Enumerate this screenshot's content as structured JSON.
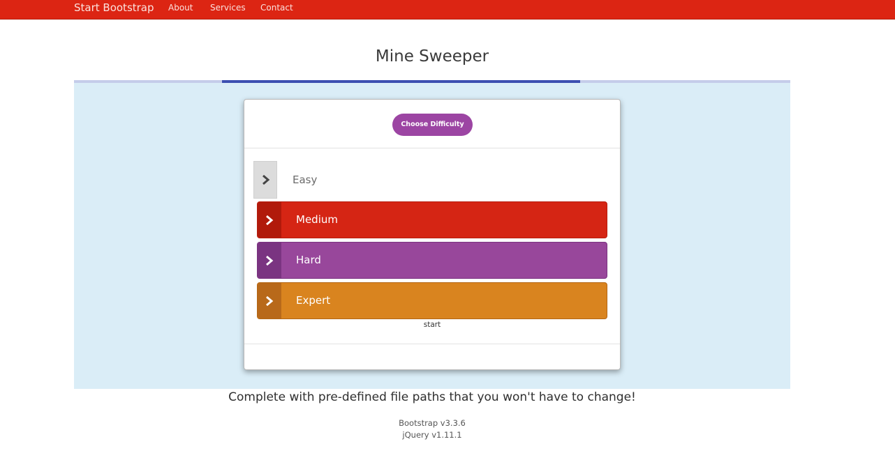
{
  "navbar": {
    "brand": "Start Bootstrap",
    "links": [
      "About",
      "Services",
      "Contact"
    ]
  },
  "main": {
    "title": "Mine Sweeper"
  },
  "card": {
    "choose_label": "Choose Difficulty",
    "options": [
      {
        "label": "Easy",
        "icon": "chevron-right-icon"
      },
      {
        "label": "Medium",
        "icon": "chevron-right-icon"
      },
      {
        "label": "Hard",
        "icon": "chevron-right-icon"
      },
      {
        "label": "Expert",
        "icon": "chevron-right-icon"
      }
    ],
    "start_label": "start"
  },
  "footer": {
    "tagline": "Complete with pre-defined file paths that you won't have to change!",
    "versions": [
      "Bootstrap v3.3.6",
      "jQuery v1.11.1"
    ]
  },
  "colors": {
    "navbar": "#dc2513",
    "stage": "#daedf7",
    "tab_active": "#3c4fb1",
    "tab_inactive": "#c5cdea",
    "choose_button": "#9c45a3",
    "medium": "#d52514",
    "hard": "#98479b",
    "expert": "#d9841f"
  }
}
